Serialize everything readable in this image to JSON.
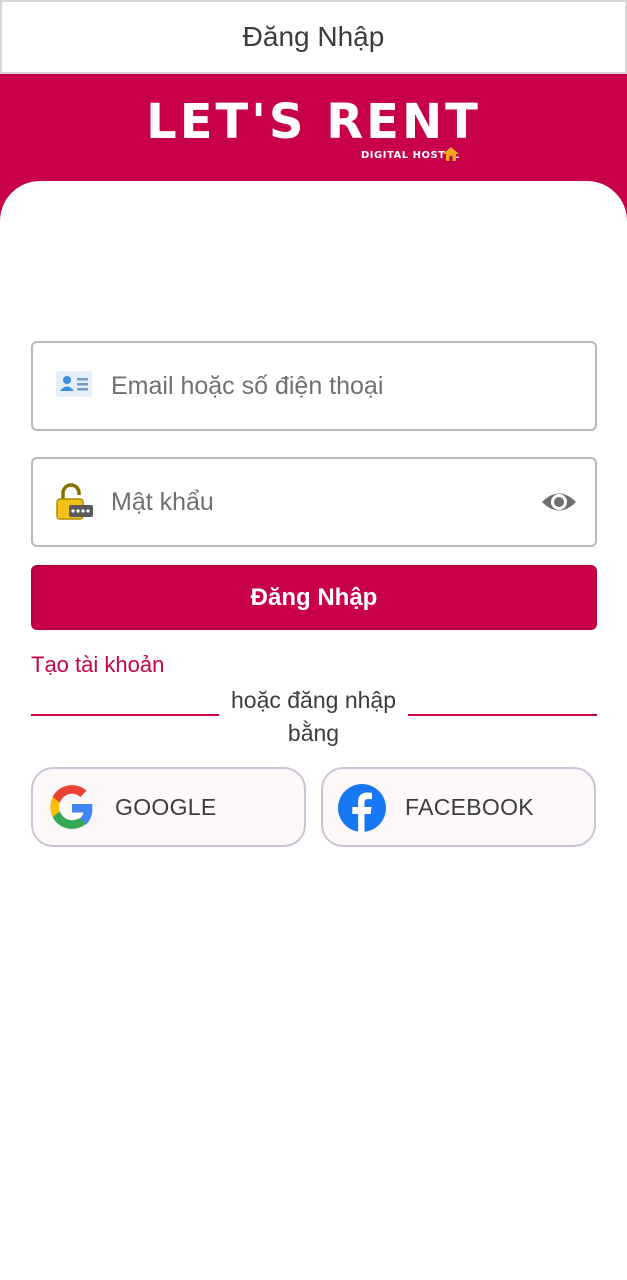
{
  "appbar": {
    "title": "Đăng Nhập"
  },
  "brand": {
    "title": "LET'S RENT",
    "subtitle": "DIGITAL HOSTEL"
  },
  "form": {
    "email_placeholder": "Email hoặc số điện thoại",
    "password_placeholder": "Mật khẩu",
    "login_label": "Đăng Nhập",
    "create_account_label": "Tạo tài khoản",
    "divider_text": "hoặc đăng nhập bằng"
  },
  "social": {
    "google_label": "GOOGLE",
    "facebook_label": "FACEBOOK"
  },
  "colors": {
    "brand": "#c8004a",
    "field_border": "#b9b9b9",
    "social_border": "#ccc4d6",
    "facebook_blue": "#1877f2"
  },
  "icons": {
    "email_field": "contact-card-icon",
    "password_field": "padlock-icon",
    "password_toggle": "eye-icon",
    "google": "google-icon",
    "facebook": "facebook-icon",
    "brand_home": "home-icon"
  }
}
